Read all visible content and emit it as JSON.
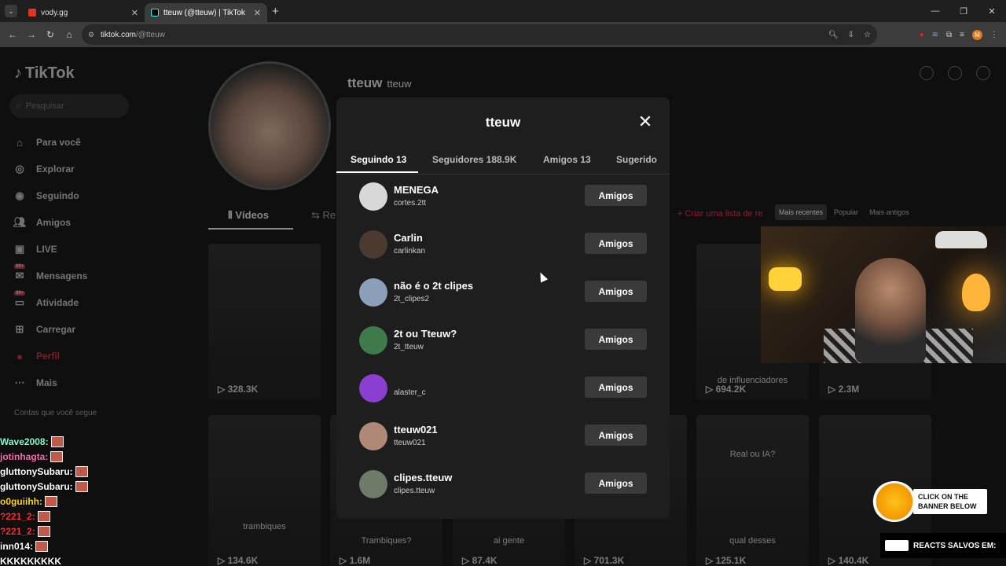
{
  "browser": {
    "tabs": [
      {
        "title": "vody.gg",
        "close": "✕"
      },
      {
        "title": "tteuw (@tteuw) | TikTok",
        "close": "✕"
      }
    ],
    "new_tab": "+",
    "url_domain": "tiktok.com",
    "url_path": "/@tteuw",
    "window_controls": [
      "—",
      "❐",
      "✕"
    ],
    "profile_initial": "M"
  },
  "sidebar": {
    "logo": "TikTok",
    "search_placeholder": "Pesquisar",
    "items": [
      {
        "label": "Para você",
        "icon": "home-icon"
      },
      {
        "label": "Explorar",
        "icon": "compass-icon"
      },
      {
        "label": "Seguindo",
        "icon": "following-icon"
      },
      {
        "label": "Amigos",
        "icon": "friends-icon"
      },
      {
        "label": "LIVE",
        "icon": "live-icon"
      },
      {
        "label": "Mensagens",
        "icon": "messages-icon",
        "badge": "99+"
      },
      {
        "label": "Atividade",
        "icon": "activity-icon",
        "badge": "99+"
      },
      {
        "label": "Carregar",
        "icon": "upload-icon"
      },
      {
        "label": "Perfil",
        "icon": "profile-icon"
      },
      {
        "label": "Mais",
        "icon": "more-icon"
      }
    ],
    "following_header": "Contas que você segue"
  },
  "profile": {
    "name": "tteuw",
    "handle": "tteuw",
    "tabs": {
      "videos": "Vídeos",
      "reposts": "Re"
    },
    "create_list": "+ Criar uma lista de re",
    "sort": [
      "Mais recentes",
      "Popular",
      "Mais antigos"
    ]
  },
  "videos": [
    {
      "views": "328.3K",
      "caption": ""
    },
    {
      "views": "694.2K",
      "caption": "de influenciadores"
    },
    {
      "views": "2.3M",
      "caption": ""
    },
    {
      "views": "134.6K",
      "caption": "trambiques"
    },
    {
      "views": "1.6M",
      "caption": "Trambiques?"
    },
    {
      "views": "87.4K",
      "caption": "ai gente"
    },
    {
      "views": "701.3K",
      "caption": ""
    },
    {
      "views": "125.1K",
      "caption": "qual desses"
    },
    {
      "views": "140.4K",
      "caption": ""
    },
    {
      "caption": "Real ou IA?"
    }
  ],
  "modal": {
    "title": "tteuw",
    "close": "✕",
    "tabs": [
      "Seguindo 13",
      "Seguidores 188.9K",
      "Amigos 13",
      "Sugerido"
    ],
    "rows": [
      {
        "name": "MENEGA",
        "username": "cortes.2tt",
        "button": "Amigos",
        "color": "#d8d8d8"
      },
      {
        "name": "Carlin",
        "username": "carlinkan",
        "button": "Amigos",
        "color": "#4a3a30"
      },
      {
        "name": "não é o 2t clipes",
        "username": "2t_clipes2",
        "button": "Amigos",
        "color": "#8aa0b8"
      },
      {
        "name": "2t ou Tteuw?",
        "username": "2t_tteuw",
        "button": "Amigos",
        "color": "#3f7a4a"
      },
      {
        "name": "",
        "username": "alaster_c",
        "button": "Amigos",
        "color": "#8a3fd0"
      },
      {
        "name": "tteuw021",
        "username": "tteuw021",
        "button": "Amigos",
        "color": "#b08878"
      },
      {
        "name": "clipes.tteuw",
        "username": "clipes.tteuw",
        "button": "Amigos",
        "color": "#6f7a68"
      }
    ]
  },
  "chat": [
    {
      "user": "Wave2008:",
      "color": "#7fffd4"
    },
    {
      "user": "jotinhagta:",
      "color": "#ff69b4"
    },
    {
      "user": "gluttonySubaru:",
      "color": "#ffffff"
    },
    {
      "user": "gluttonySubaru:",
      "color": "#ffffff"
    },
    {
      "user": "o0guiihh:",
      "color": "#ffd700"
    },
    {
      "user": "?221_2:",
      "color": "#ff3030"
    },
    {
      "user": "?221_2:",
      "color": "#ff3030"
    },
    {
      "user": "inn014:",
      "color": "#ffffff"
    },
    {
      "user": "KKKKKKKKK",
      "color": "#ffffff"
    }
  ],
  "banners": {
    "click": "CLICK ON THE BANNER BELOW",
    "reacts": "REACTS SALVOS EM:"
  }
}
